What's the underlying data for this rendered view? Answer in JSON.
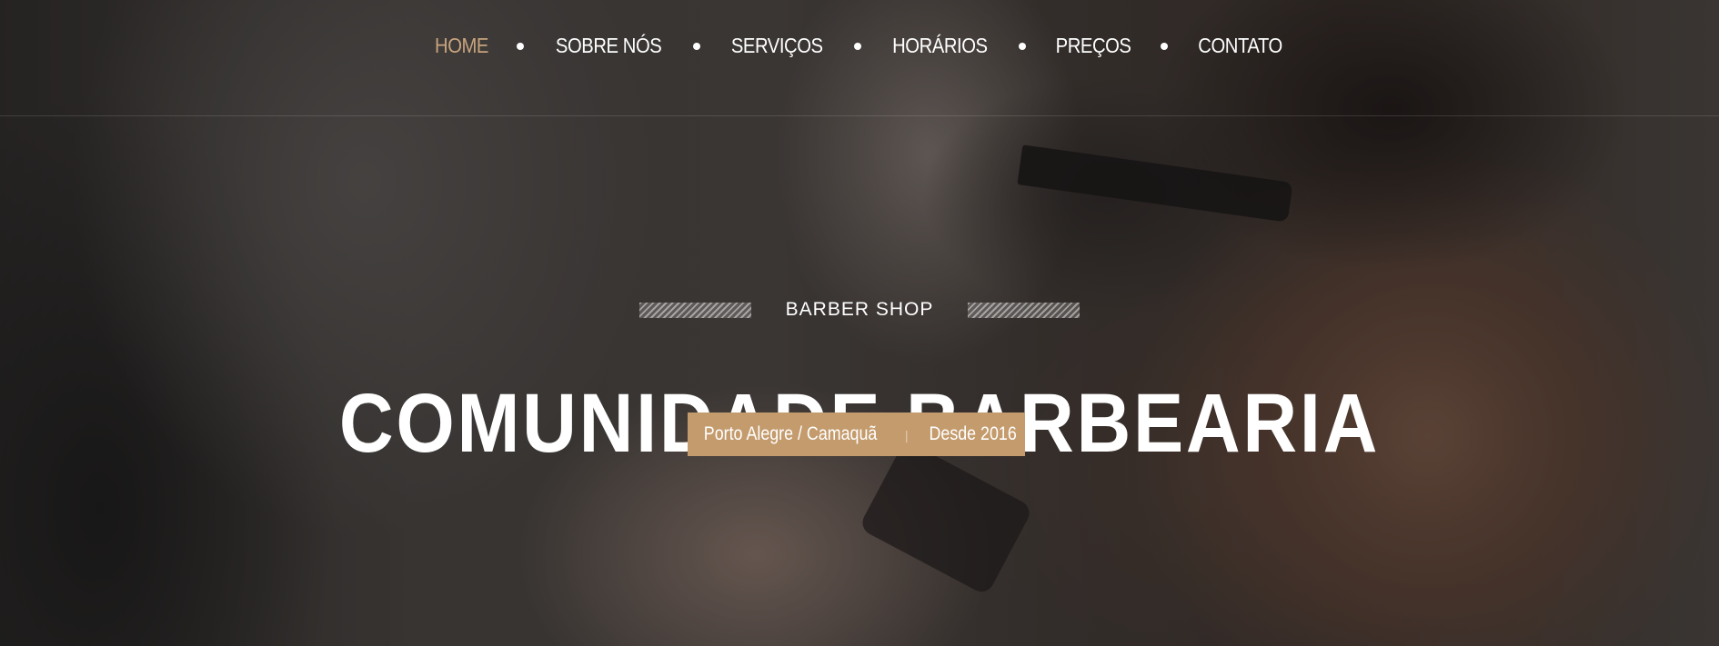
{
  "nav": {
    "items": [
      {
        "label": "HOME",
        "active": true
      },
      {
        "label": "SOBRE NÓS"
      },
      {
        "label": "SERVIÇOS"
      },
      {
        "label": "HORÁRIOS"
      },
      {
        "label": "PREÇOS"
      },
      {
        "label": "CONTATO"
      }
    ]
  },
  "hero": {
    "tagline": "BARBER SHOP",
    "title": "COMUNIDADE BARBEARIA",
    "location": "Porto Alegre / Camaquã",
    "separator": "|",
    "since": "Desde 2016"
  },
  "colors": {
    "accent": "#c49b6d",
    "nav_active": "#c8a47e",
    "text": "#ffffff"
  }
}
